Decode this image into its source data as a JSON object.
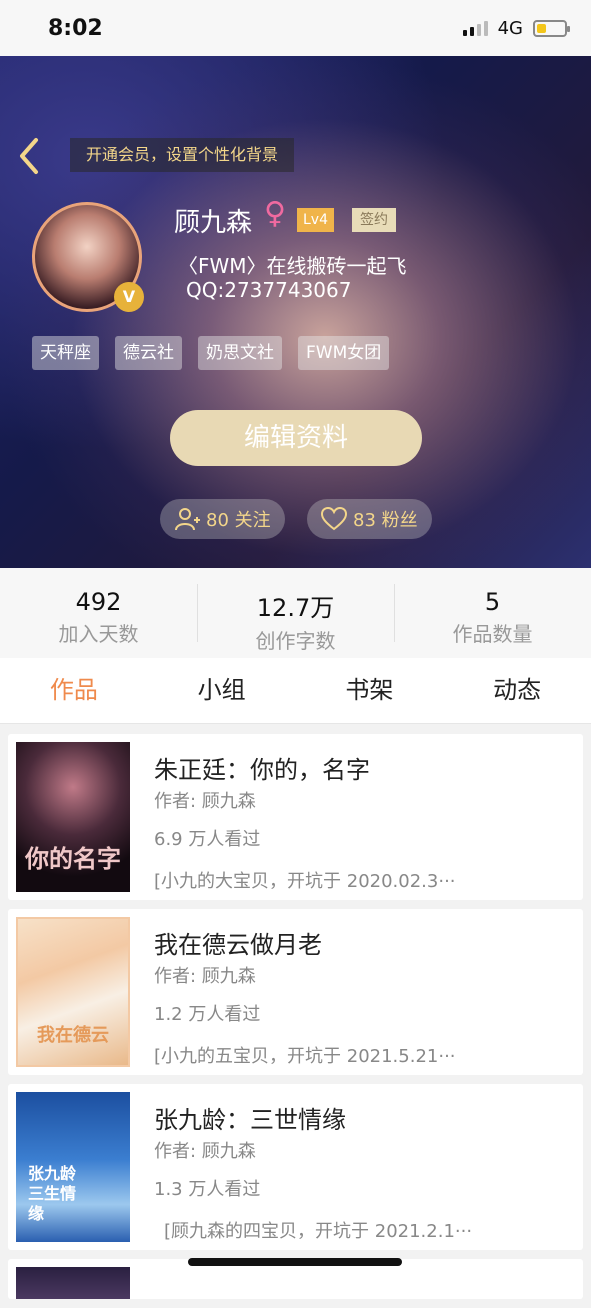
{
  "status": {
    "time": "8:02",
    "network": "4G",
    "battery_level": 0.35
  },
  "header": {
    "banner": "开通会员，设置个性化背景",
    "username": "顾九森",
    "gender_symbol": "♀",
    "level": "Lv4",
    "signed": "签约",
    "avatar_badge": "V",
    "bio": "〈FWM〉在线搬砖一起飞",
    "qq": "QQ:2737743067",
    "tags": [
      "天秤座",
      "德云社",
      "奶思文社",
      "FWM女团"
    ],
    "edit_label": "编辑资料",
    "following": "80 关注",
    "fans": "83 粉丝"
  },
  "stats": [
    {
      "value": "492",
      "label": "加入天数"
    },
    {
      "value": "12.7万",
      "label": "创作字数"
    },
    {
      "value": "5",
      "label": "作品数量"
    }
  ],
  "tabs": [
    "作品",
    "小组",
    "书架",
    "动态"
  ],
  "works": [
    {
      "title": "朱正廷：你的，名字",
      "author": "作者: 顾九森",
      "views": "6.9 万人看过",
      "desc": "[小九的大宝贝，开坑于 2020.02.3···",
      "cover_text": "你的名字"
    },
    {
      "title": "我在德云做月老",
      "author": "作者: 顾九森",
      "views": "1.2 万人看过",
      "desc": "[小九的五宝贝，开坑于 2021.5.21···",
      "cover_text": "我在德云"
    },
    {
      "title": "张九龄：三世情缘",
      "author": "作者: 顾九森",
      "views": "1.3 万人看过",
      "desc": "[顾九森的四宝贝，开坑于 2021.2.1···",
      "cover_text": "张九龄三生情缘"
    }
  ],
  "colors": {
    "accent": "#ef8a4c",
    "gold": "#f3d68a",
    "level": "#f0b44a"
  }
}
